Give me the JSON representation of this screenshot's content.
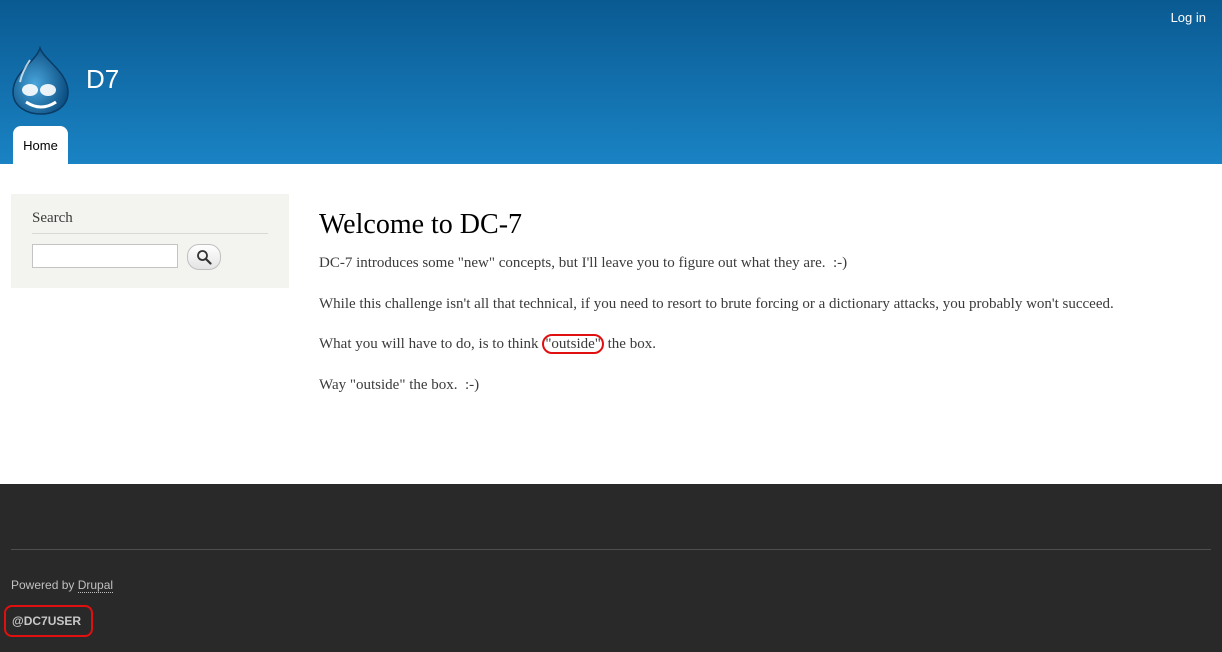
{
  "header": {
    "login_label": "Log in",
    "site_name": "D7",
    "logo_icon": "drupal-drop-icon",
    "nav": [
      {
        "label": "Home"
      }
    ]
  },
  "sidebar": {
    "search_title": "Search",
    "search_placeholder": "",
    "search_button_icon": "magnifier-icon"
  },
  "main": {
    "title": "Welcome to DC-7",
    "paragraphs": [
      "DC-7 introduces some \"new\" concepts, but I'll leave you to figure out what they are.  :-)",
      "While this challenge isn't all that technical, if you need to resort to brute forcing or a dictionary attacks, you probably won't succeed.",
      {
        "before": "What you will have to do, is to think ",
        "highlight": "\"outside\"",
        "after": " the box."
      },
      "Way \"outside\" the box.  :-)"
    ]
  },
  "footer": {
    "powered_prefix": "Powered by ",
    "powered_link": "Drupal",
    "user_tag": "@DC7USER"
  },
  "colors": {
    "header_top": "#0a5a92",
    "header_bottom": "#1a83c4",
    "footer_bg": "#292929",
    "highlight_border": "#e01010"
  }
}
